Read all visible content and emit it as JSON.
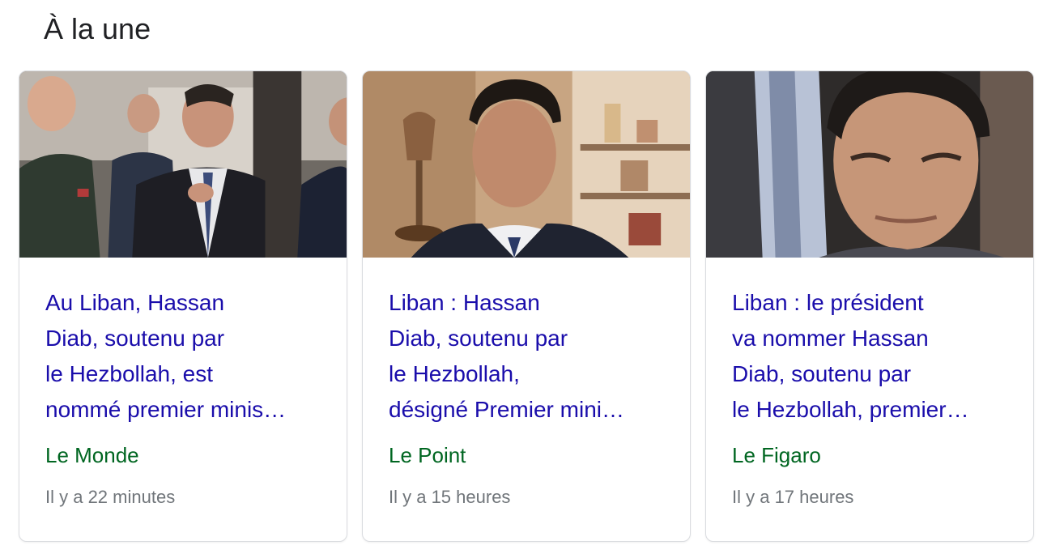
{
  "section": {
    "title": "À la une"
  },
  "cards": [
    {
      "headline": "Au Liban, Hassan\nDiab, soutenu par\nle Hezbollah, est\nnommé premier minis…",
      "source": "Le Monde",
      "time": "Il y a 22 minutes",
      "image_icon": "news-photo"
    },
    {
      "headline": "Liban : Hassan\nDiab, soutenu par\nle Hezbollah,\ndésigné Premier mini…",
      "source": "Le Point",
      "time": "Il y a 15 heures",
      "image_icon": "news-photo"
    },
    {
      "headline": "Liban : le président\nva nommer Hassan\nDiab, soutenu par\nle Hezbollah, premier…",
      "source": "Le Figaro",
      "time": "Il y a 17 heures",
      "image_icon": "news-photo"
    }
  ],
  "colors": {
    "headline": "#1a0dab",
    "source": "#006621",
    "time": "#70757a",
    "title": "#202124",
    "card_border": "#dadce0"
  }
}
